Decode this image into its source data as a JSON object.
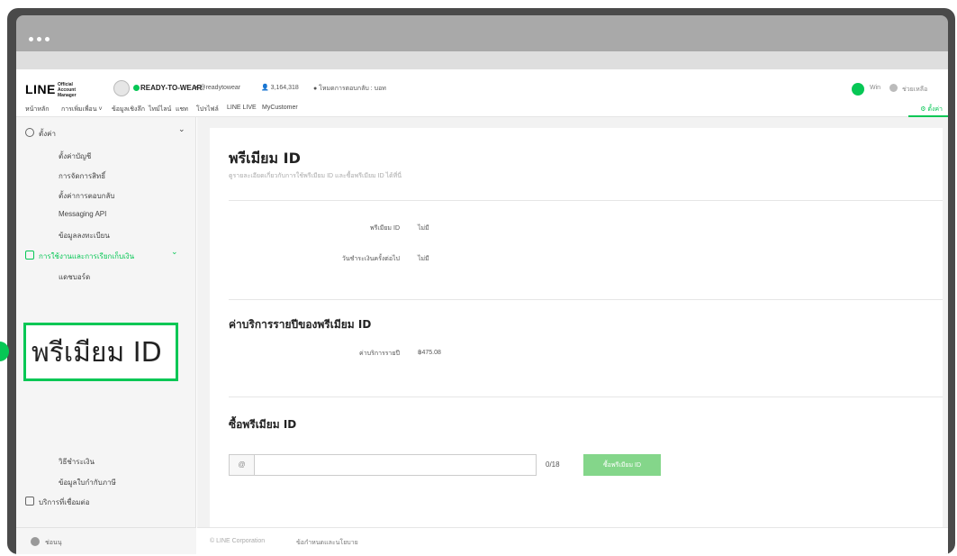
{
  "header": {
    "logo": "LINE",
    "logo_sub": "Official Account Manager",
    "account_name": "READY-TO-WEAR",
    "account_id": "▾ @readytowear",
    "friends": "👤 3,164,318",
    "chat_mode": "● โหมดการตอบกลับ : บอท",
    "user_label": "Win",
    "help_label": "ช่วยเหลือ"
  },
  "nav": {
    "items": [
      "หน้าหลัก",
      "การเพิ่มเพื่อน ˅",
      "ข้อมูลเชิงลึก",
      "ไทม์ไลน์",
      "แชท",
      "โปรไฟล์",
      "LINE LIVE",
      "MyCustomer"
    ],
    "settings": "⚙ ตั้งค่า"
  },
  "sidebar": {
    "settings_title": "ตั้งค่า",
    "settings_items": [
      "ตั้งค่าบัญชี",
      "การจัดการสิทธิ์",
      "ตั้งค่าการตอบกลับ",
      "Messaging API",
      "ข้อมูลลงทะเบียน"
    ],
    "billing_title": "การใช้งานและการเรียกเก็บเงิน",
    "billing_items": [
      "แดชบอร์ด",
      "วิธีชำระเงิน",
      "ข้อมูลใบกำกับภาษี"
    ],
    "services_title": "บริการที่เชื่อมต่อ",
    "user": "ช่อนนุ"
  },
  "zoom": {
    "label": "พรีเมียม ID"
  },
  "main": {
    "title": "พรีเมียม ID",
    "subtitle": "ดูรายละเอียดเกี่ยวกับการใช้พรีเมียม ID และซื้อพรีเมียม ID ได้ที่นี่",
    "premium_label": "พรีเมียม ID",
    "premium_value": "ไม่มี",
    "next_payment_label": "วันชำระเงินครั้งต่อไป",
    "next_payment_value": "ไม่มี",
    "annual_title": "ค่าบริการรายปีของพรีเมียม ID",
    "annual_label": "ค่าบริการรายปี",
    "annual_value": "฿475.08",
    "buy_title": "ซื้อพรีเมียม ID",
    "at_symbol": "@",
    "input_value": "",
    "counter": "0/18",
    "buy_button": "ซื้อพรีเมียม ID"
  },
  "footer": {
    "copyright": "© LINE Corporation",
    "terms": "ข้อกำหนดและนโยบาย"
  },
  "colors": {
    "accent": "#06c755",
    "button": "#84d68a"
  }
}
